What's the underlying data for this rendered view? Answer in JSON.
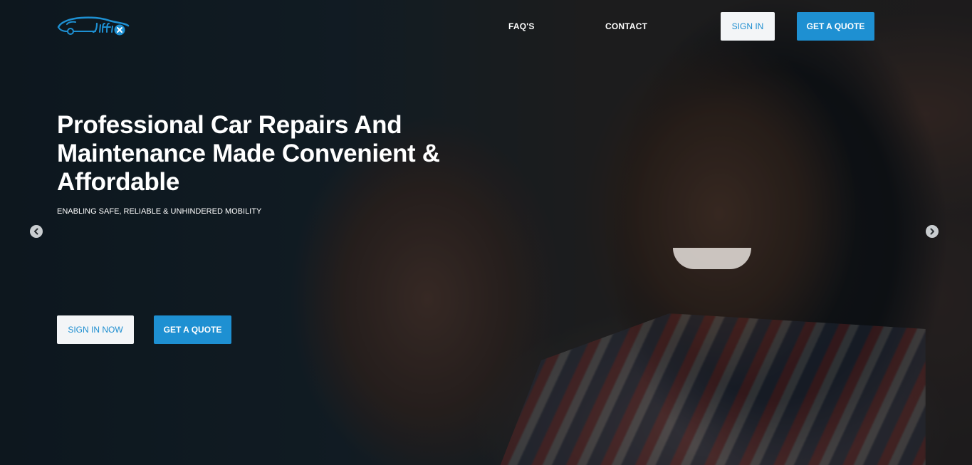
{
  "header": {
    "logo_text": "Jiffix",
    "nav": {
      "faqs": "FAQ'S",
      "contact": "CONTACT"
    },
    "sign_in": "SIGN IN",
    "get_quote": "GET A QUOTE"
  },
  "hero": {
    "headline": "Professional Car Repairs And Maintenance Made Convenient & Affordable",
    "tagline": "ENABLING SAFE, RELIABLE & UNHINDERED MOBILITY",
    "sign_in_now": "SIGN IN NOW",
    "get_quote": "GET A QUOTE"
  },
  "carousel": {
    "prev_icon": "chevron-left-icon",
    "next_icon": "chevron-right-icon"
  },
  "colors": {
    "accent": "#1e90d2",
    "light_button": "#f3f5f7"
  }
}
